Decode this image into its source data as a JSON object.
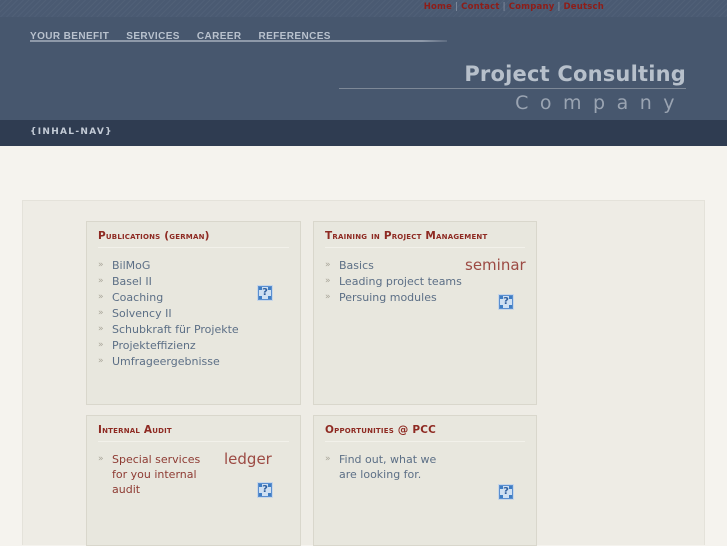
{
  "top_bar": {
    "links": [
      {
        "label": "Home"
      },
      {
        "label": "Contact"
      },
      {
        "label": "Company"
      },
      {
        "label": "Deutsch"
      }
    ],
    "separator": "|"
  },
  "main_nav": {
    "items": [
      {
        "label": "YOUR BENEFIT"
      },
      {
        "label": "SERVICES"
      },
      {
        "label": "CAREER"
      },
      {
        "label": "REFERENCES"
      }
    ]
  },
  "logo": {
    "line1": "Project Consulting",
    "line2": "Company"
  },
  "section_bar": {
    "label": "{INHAL-NAV}"
  },
  "cards": {
    "publications": {
      "title": "Publications (german)",
      "items": [
        {
          "label": "BilMoG"
        },
        {
          "label": "Basel II"
        },
        {
          "label": "Coaching"
        },
        {
          "label": "Solvency II"
        },
        {
          "label": "Schubkraft für Projekte"
        },
        {
          "label": "Projekteffizienz"
        },
        {
          "label": "Umfrageergebnisse"
        }
      ],
      "placeholder_alt": "?"
    },
    "training": {
      "title": "Training in Project Management",
      "items": [
        {
          "label": "Basics"
        },
        {
          "label": "Leading project teams"
        },
        {
          "label": "Persuing modules"
        }
      ],
      "side_word": "seminar",
      "placeholder_alt": "?"
    },
    "internal_audit": {
      "title": "Internal Audit",
      "items": [
        {
          "label": "Special services for you internal audit"
        }
      ],
      "side_word": "ledger",
      "placeholder_alt": "?"
    },
    "opportunities": {
      "title": "Opportunities @ PCC",
      "items": [
        {
          "label": "Find out, what we are looking for."
        }
      ],
      "placeholder_alt": "?"
    }
  },
  "icons": {
    "bullet": "»"
  },
  "colors": {
    "header_band": "#47576e",
    "top_strip": "#4a5a72",
    "section_bar": "#2f3c51",
    "page_bg": "#f5f3ee",
    "card_bg": "#e8e7de",
    "title_red": "#8e2a22",
    "link_blue_gray": "#5c6f86",
    "accent_red": "#9c4a43"
  }
}
